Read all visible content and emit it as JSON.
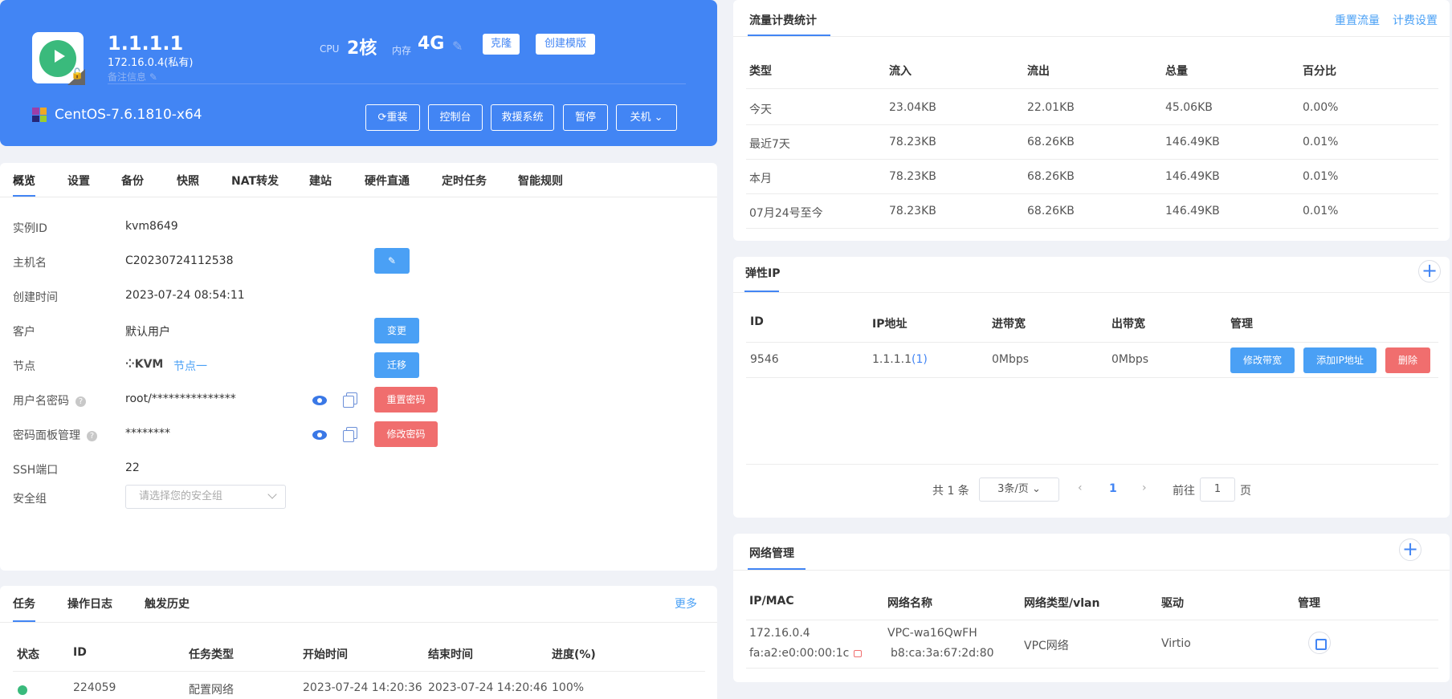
{
  "instance": {
    "ip": "1.1.1.1",
    "private_ip": "172.16.0.4(私有)",
    "note_placeholder": "备注信息",
    "cpu_label": "CPU",
    "cpu_value": "2核",
    "mem_label": "内存",
    "mem_value": "4G",
    "clone_label": "克隆",
    "create_template_label": "创建模版",
    "os_name": "CentOS-7.6.1810-x64",
    "actions": {
      "reinstall": "重装",
      "console": "控制台",
      "rescue": "救援系统",
      "pause": "暂停",
      "shutdown": "关机"
    }
  },
  "tabs": [
    "概览",
    "设置",
    "备份",
    "快照",
    "NAT转发",
    "建站",
    "硬件直通",
    "定时任务",
    "智能规则"
  ],
  "overview": {
    "instance_id_label": "实例ID",
    "instance_id": "kvm8649",
    "hostname_label": "主机名",
    "hostname": "C20230724112538",
    "created_label": "创建时间",
    "created": "2023-07-24 08:54:11",
    "customer_label": "客户",
    "customer": "默认用户",
    "customer_btn": "变更",
    "node_label": "节点",
    "node_type": "KVM",
    "node_name": "节点一",
    "node_btn": "迁移",
    "userpass_label": "用户名密码",
    "userpass": "root/***************",
    "reset_pwd_btn": "重置密码",
    "panel_pwd_label": "密码面板管理",
    "panel_pwd": "********",
    "change_pwd_btn": "修改密码",
    "ssh_label": "SSH端口",
    "ssh_port": "22",
    "secgroup_label": "安全组",
    "secgroup_placeholder": "请选择您的安全组"
  },
  "tasks": {
    "tabs": [
      "任务",
      "操作日志",
      "触发历史"
    ],
    "more": "更多",
    "headers": [
      "状态",
      "ID",
      "任务类型",
      "开始时间",
      "结束时间",
      "进度(%)"
    ],
    "rows": [
      {
        "id": "224059",
        "type": "配置网络",
        "start": "2023-07-24 14:20:36",
        "end": "2023-07-24 14:20:46",
        "progress": "100%"
      }
    ]
  },
  "traffic": {
    "title": "流量计费统计",
    "reset_link": "重置流量",
    "billing_link": "计费设置",
    "headers": [
      "类型",
      "流入",
      "流出",
      "总量",
      "百分比"
    ],
    "rows": [
      [
        "今天",
        "23.04KB",
        "22.01KB",
        "45.06KB",
        "0.00%"
      ],
      [
        "最近7天",
        "78.23KB",
        "68.26KB",
        "146.49KB",
        "0.01%"
      ],
      [
        "本月",
        "78.23KB",
        "68.26KB",
        "146.49KB",
        "0.01%"
      ],
      [
        "07月24号至今",
        "78.23KB",
        "68.26KB",
        "146.49KB",
        "0.01%"
      ]
    ]
  },
  "eip": {
    "title": "弹性IP",
    "headers": [
      "ID",
      "IP地址",
      "进带宽",
      "出带宽",
      "管理"
    ],
    "row": {
      "id": "9546",
      "ip": "1.1.1.1",
      "ip_count": "(1)",
      "in_bw": "0Mbps",
      "out_bw": "0Mbps"
    },
    "btn_modify_bw": "修改带宽",
    "btn_add_ip": "添加IP地址",
    "btn_delete": "删除",
    "pager": {
      "total": "共 1 条",
      "page_size": "3条/页",
      "current": "1",
      "goto_label": "前往",
      "goto_value": "1",
      "page_suffix": "页"
    }
  },
  "network": {
    "title": "网络管理",
    "headers": [
      "IP/MAC",
      "网络名称",
      "网络类型/vlan",
      "驱动",
      "管理"
    ],
    "row": {
      "ip": "172.16.0.4",
      "mac": "fa:a2:e0:00:00:1c",
      "net_name": "VPC-wa16QwFH",
      "net_mac": "b8:ca:3a:67:2d:80",
      "net_type": "VPC网络",
      "driver": "Virtio"
    }
  },
  "colors": {
    "primary": "#4285f4",
    "button_blue": "#4aa0f5",
    "danger": "#f06e6e",
    "success": "#3aba7c"
  }
}
